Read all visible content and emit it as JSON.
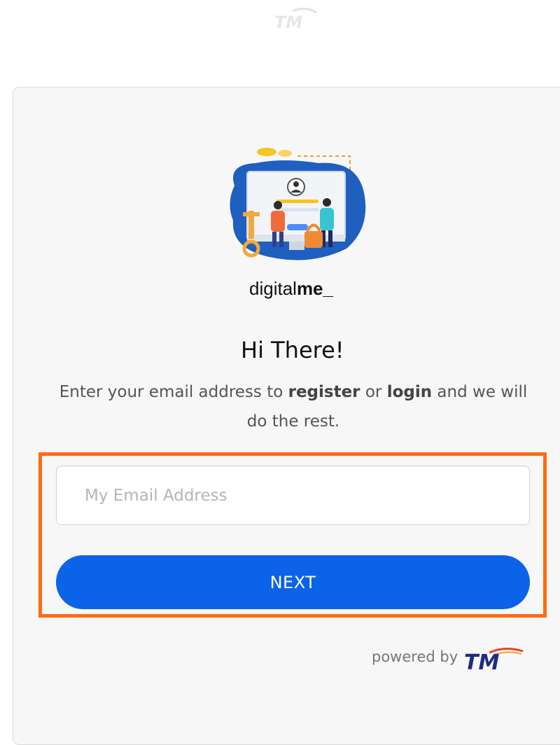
{
  "brand": {
    "top_logo_text": "TM",
    "app_name_regular": "digital",
    "app_name_bold": "me_",
    "powered_by_text": "powered by",
    "powered_logo_text": "TM"
  },
  "form": {
    "title": "Hi There!",
    "description": {
      "part1": "Enter your email address to ",
      "bold1": "register",
      "part2": " or ",
      "bold2": "login",
      "part3": " and we will do the rest."
    },
    "email_placeholder": "My Email Address",
    "email_value": "",
    "next_label": "NEXT"
  },
  "colors": {
    "accent_blue": "#0b63ea",
    "highlight_orange": "#ff6a14",
    "card_bg": "#f7f7f7"
  }
}
